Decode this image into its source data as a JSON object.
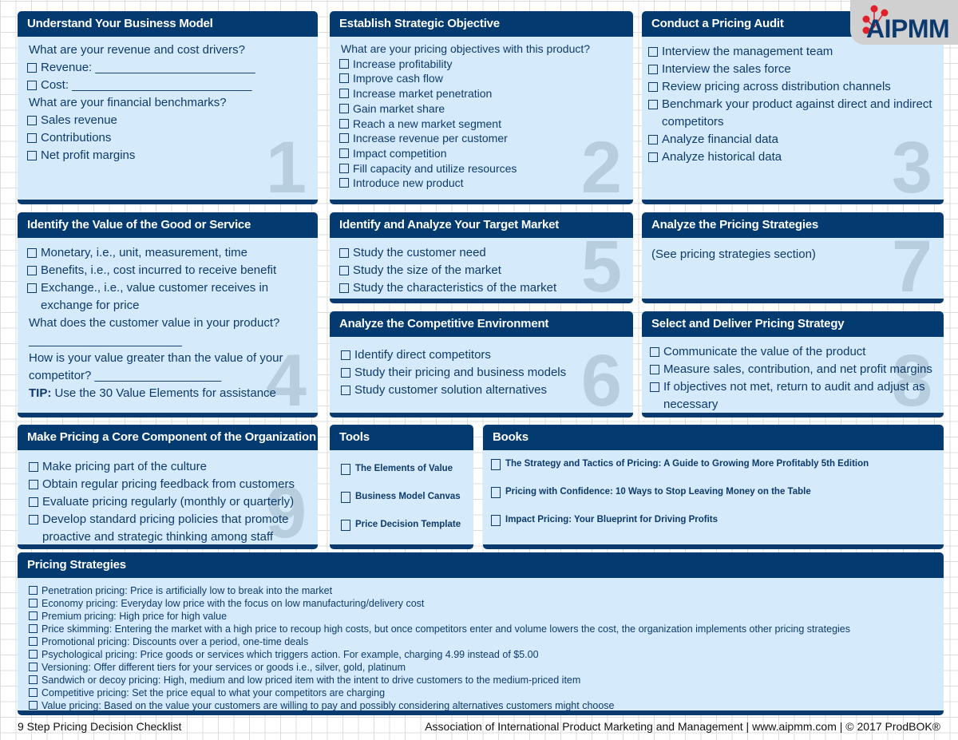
{
  "logo": {
    "text": "AIPMM",
    "accent": "#e0202a",
    "brand": "#033a70"
  },
  "cards": [
    {
      "title": "Understand Your Business Model",
      "number": "1",
      "items": [
        {
          "type": "q",
          "text": "What are your revenue and cost drivers?"
        },
        {
          "type": "check",
          "text": "Revenue: ________________________"
        },
        {
          "type": "check",
          "text": "Cost: ___________________________"
        },
        {
          "type": "q",
          "text": "What are your financial benchmarks?"
        },
        {
          "type": "check",
          "text": "Sales revenue"
        },
        {
          "type": "check",
          "text": "Contributions"
        },
        {
          "type": "check",
          "text": "Net profit margins"
        }
      ]
    },
    {
      "title": "Establish Strategic Objective",
      "number": "2",
      "items": [
        {
          "type": "q",
          "text": "What are your pricing objectives with this product?"
        },
        {
          "type": "check",
          "text": "Increase profitability"
        },
        {
          "type": "check",
          "text": "Improve cash flow"
        },
        {
          "type": "check",
          "text": "Increase market penetration"
        },
        {
          "type": "check",
          "text": "Gain market share"
        },
        {
          "type": "check",
          "text": "Reach a new market segment"
        },
        {
          "type": "check",
          "text": "Increase revenue per customer"
        },
        {
          "type": "check",
          "text": "Impact competition"
        },
        {
          "type": "check",
          "text": "Fill capacity and utilize resources"
        },
        {
          "type": "check",
          "text": "Introduce new product"
        }
      ]
    },
    {
      "title": "Conduct a Pricing Audit",
      "number": "3",
      "items": [
        {
          "type": "check",
          "text": "Interview the management team"
        },
        {
          "type": "check",
          "text": "Interview the sales force"
        },
        {
          "type": "check",
          "text": "Review pricing across distribution channels"
        },
        {
          "type": "check",
          "text": "Benchmark your product against direct and indirect competitors"
        },
        {
          "type": "check",
          "text": "Analyze financial data"
        },
        {
          "type": "check",
          "text": "Analyze historical data"
        }
      ]
    },
    {
      "title": "Identify the Value of the Good or Service",
      "number": "4",
      "items": [
        {
          "type": "check",
          "text": "Monetary, i.e., unit, measurement, time"
        },
        {
          "type": "check",
          "text": "Benefits, i.e., cost incurred to receive benefit"
        },
        {
          "type": "check",
          "text": "Exchange., i.e., value customer receives in exchange for price"
        },
        {
          "type": "q",
          "text": "What does the customer value in your product?"
        },
        {
          "type": "q",
          "text": "_______________________"
        },
        {
          "type": "q",
          "text": "How is your value greater than the value of your competitor? ___________________"
        },
        {
          "type": "tip",
          "label": "TIP:",
          "text": " Use the 30 Value Elements for assistance"
        }
      ]
    },
    {
      "title": "Identify and Analyze Your Target Market",
      "number": "5",
      "items": [
        {
          "type": "check",
          "text": "Study the customer need"
        },
        {
          "type": "check",
          "text": "Study the size of the market"
        },
        {
          "type": "check",
          "text": "Study the characteristics of the market"
        }
      ]
    },
    {
      "title": "Analyze the Competitive Environment",
      "number": "6",
      "items": [
        {
          "type": "check",
          "text": "Identify direct competitors"
        },
        {
          "type": "check",
          "text": "Study their pricing and business models"
        },
        {
          "type": "check",
          "text": "Study customer solution alternatives"
        }
      ]
    },
    {
      "title": "Analyze the Pricing Strategies",
      "number": "7",
      "items": [
        {
          "type": "q",
          "text": "(See pricing strategies section)"
        }
      ]
    },
    {
      "title": "Select and Deliver Pricing Strategy",
      "number": "8",
      "items": [
        {
          "type": "check",
          "text": "Communicate the value of the product"
        },
        {
          "type": "check",
          "text": "Measure sales, contribution, and net profit margins"
        },
        {
          "type": "check",
          "text": "If objectives not met, return to audit and adjust as necessary"
        }
      ]
    },
    {
      "title": "Make Pricing a Core Component of the Organization",
      "number": "9",
      "items": [
        {
          "type": "check",
          "text": "Make pricing part of the culture"
        },
        {
          "type": "check",
          "text": "Obtain regular pricing feedback from customers"
        },
        {
          "type": "check",
          "text": "Evaluate pricing regularly (monthly or quarterly)"
        },
        {
          "type": "check",
          "text": "Develop standard pricing policies that promote proactive and strategic thinking among staff"
        }
      ]
    },
    {
      "title": "Tools",
      "number": "",
      "items": [
        {
          "type": "check",
          "text": "The Elements of Value"
        },
        {
          "type": "check",
          "text": "Business Model Canvas"
        },
        {
          "type": "check",
          "text": "Price Decision Template"
        }
      ]
    },
    {
      "title": "Books",
      "number": "",
      "items": [
        {
          "type": "check",
          "text": "The Strategy and Tactics of Pricing: A Guide to Growing More Profitably 5th Edition"
        },
        {
          "type": "check",
          "text": "Pricing with Confidence: 10 Ways to Stop Leaving Money on the Table"
        },
        {
          "type": "check",
          "text": "Impact Pricing: Your Blueprint for Driving Profits"
        }
      ]
    },
    {
      "title": "Pricing Strategies",
      "number": "",
      "items": [
        {
          "type": "check",
          "text": "Penetration pricing: Price is artificially low to break into the market"
        },
        {
          "type": "check",
          "text": "Economy pricing: Everyday low price with the focus on low manufacturing/delivery cost"
        },
        {
          "type": "check",
          "text": "Premium pricing: High price for high value"
        },
        {
          "type": "check",
          "text": "Price skimming: Entering the market with a high price to recoup high costs, but once competitors enter and volume lowers the cost, the organization implements other pricing strategies"
        },
        {
          "type": "check",
          "text": "Promotional pricing: Discounts over a period, one-time deals"
        },
        {
          "type": "check",
          "text": "Psychological pricing: Price goods or services which triggers action. For example, charging 4.99 instead of $5.00"
        },
        {
          "type": "check",
          "text": "Versioning: Offer different tiers for your services or goods i.e., silver, gold, platinum"
        },
        {
          "type": "check",
          "text": "Sandwich or decoy pricing: High, medium and low priced item with the intent to drive customers to the medium-priced item"
        },
        {
          "type": "check",
          "text": "Competitive pricing: Set the price equal to what your competitors are charging"
        },
        {
          "type": "check",
          "text": "Value pricing: Based on the value your customers are willing to pay and possibly considering alternatives customers might choose"
        }
      ]
    }
  ],
  "footer": {
    "left": "9 Step Pricing Decision Checklist",
    "right": "Association of International Product Marketing and Management  | www.aipmm.com | © 2017  ProdBOK®"
  }
}
